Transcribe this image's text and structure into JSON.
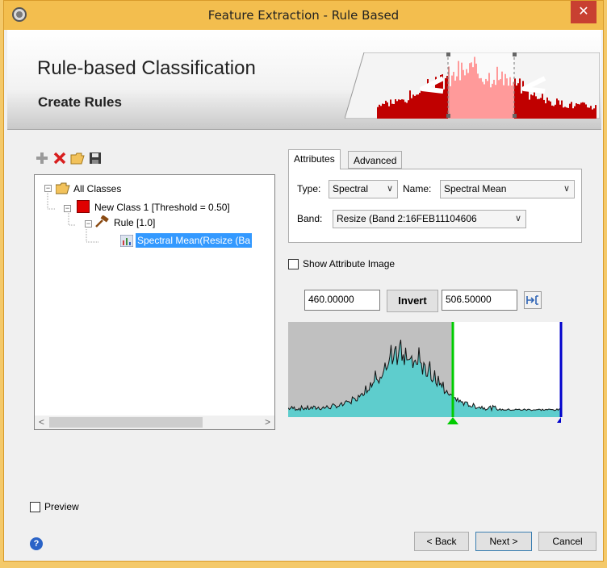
{
  "window": {
    "title": "Feature Extraction - Rule Based",
    "close_glyph": "✕"
  },
  "banner": {
    "heading": "Rule-based Classification",
    "subheading": "Create Rules"
  },
  "toolbar": {
    "icons": [
      "add-icon",
      "delete-icon",
      "open-folder-icon",
      "save-icon"
    ]
  },
  "tree": {
    "root_label": "All Classes",
    "class_label": "New Class 1 [Threshold = 0.50]",
    "class_color": "#e00000",
    "rule_label": "Rule [1.0]",
    "attribute_label": "Spectral Mean(Resize (Ba"
  },
  "tabs": [
    {
      "label": "Attributes",
      "active": true
    },
    {
      "label": "Advanced",
      "active": false
    }
  ],
  "attributes": {
    "type_label": "Type:",
    "type_value": "Spectral",
    "name_label": "Name:",
    "name_value": "Spectral Mean",
    "band_label": "Band:",
    "band_value": "Resize (Band 2:16FEB11104606"
  },
  "show_attribute_image": {
    "label": "Show Attribute Image",
    "checked": false
  },
  "threshold": {
    "min_value": "460.00000",
    "invert_label": "Invert",
    "max_value": "506.50000"
  },
  "histogram": {
    "lower_marker_color": "#00cc00",
    "upper_marker_color": "#0000cc",
    "selected_fill": "#5ecdcd"
  },
  "preview": {
    "label": "Preview",
    "checked": false
  },
  "footer": {
    "back_label": "< Back",
    "next_label": "Next >",
    "cancel_label": "Cancel"
  },
  "colors": {
    "title_bar": "#f3be4e",
    "selection": "#3399ff"
  }
}
